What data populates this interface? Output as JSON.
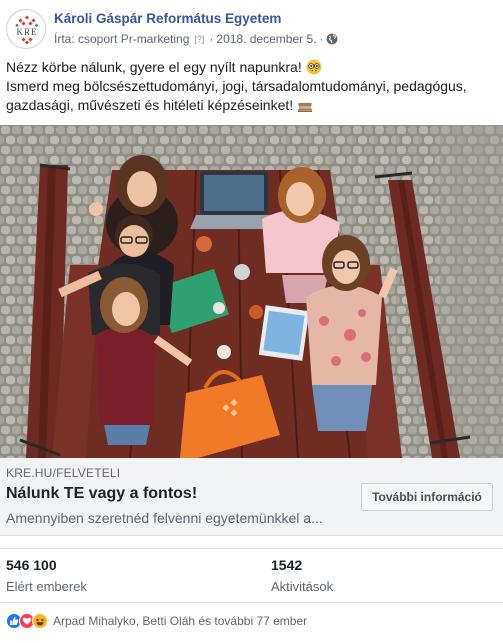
{
  "header": {
    "page_name": "Károli Gáspár Református Egyetem",
    "author": "Írta: csoport Pr-marketing",
    "help_marker": "[?]",
    "separator": "·",
    "date": "2018. december 5.",
    "separator2": "·",
    "avatar_logo_text": "KRE",
    "privacy_icon": "globe-icon"
  },
  "post": {
    "line1": "Nézz körbe nálunk, gyere el egy nyílt napunkra!",
    "line2": "Ismerd meg bölcsészettudományi, jogi, társadalomtudományi, pedagógus, gazdasági, művészeti és hitéleti képzéseinket!",
    "emoji1": "nerd-face-emoji",
    "emoji2": "books-emoji"
  },
  "link": {
    "domain": "KRE.HU/FELVETELI",
    "title": "Nálunk TE vagy a fontos!",
    "description": "Amennyiben szeretnéd felvenni egyetemünkkel a...",
    "cta": "További információ"
  },
  "stats": {
    "reach_value": "546 100",
    "reach_label": "Elért emberek",
    "engagement_value": "1542",
    "engagement_label": "Aktivitások"
  },
  "reactions": {
    "text": "Arpad Mihalyko, Betti Oláh és további 77 ember",
    "icons": [
      "like-icon",
      "love-icon",
      "haha-icon"
    ]
  },
  "colors": {
    "link_blue": "#365899",
    "muted": "#606770",
    "link_bg": "#f2f3f5",
    "like": "#1877f2",
    "love": "#f33e58",
    "haha": "#f7b125",
    "bag_orange": "#f07a28"
  }
}
